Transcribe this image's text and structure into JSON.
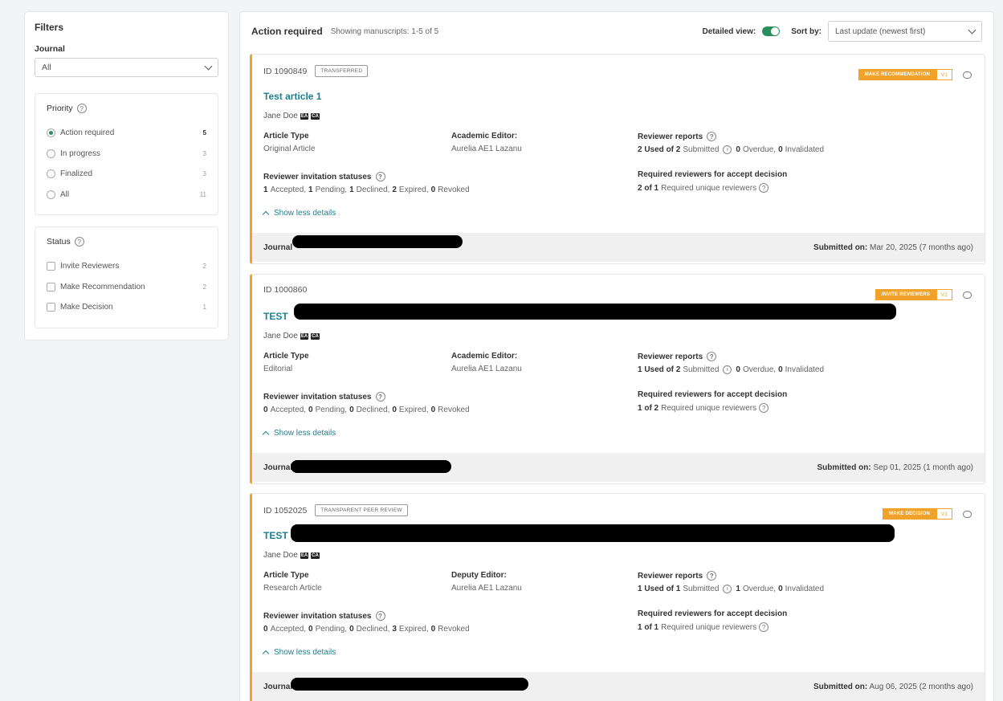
{
  "sidebar": {
    "title": "Filters",
    "journal_label": "Journal",
    "journal_value": "All",
    "priority": {
      "title": "Priority",
      "options": [
        {
          "label": "Action required",
          "count": "5",
          "selected": true
        },
        {
          "label": "In progress",
          "count": "3",
          "selected": false
        },
        {
          "label": "Finalized",
          "count": "3",
          "selected": false
        },
        {
          "label": "All",
          "count": "11",
          "selected": false
        }
      ]
    },
    "status": {
      "title": "Status",
      "options": [
        {
          "label": "Invite Reviewers",
          "count": "2"
        },
        {
          "label": "Make Recommendation",
          "count": "2"
        },
        {
          "label": "Make Decision",
          "count": "1"
        }
      ]
    }
  },
  "header": {
    "title": "Action required",
    "showing": "Showing manuscripts: 1-5 of 5",
    "detailed_view_label": "Detailed view:",
    "sort_label": "Sort by:",
    "sort_value": "Last update (newest first)"
  },
  "cards": [
    {
      "id": "ID 1090849",
      "pill": "TRANSFERRED",
      "badge": "MAKE RECOMMENDATION",
      "version": "V1",
      "title": "Test article 1",
      "author": "Jane Doe",
      "tags": [
        "EA",
        "CA"
      ],
      "article_type_label": "Article Type",
      "article_type": "Original Article",
      "editor_label": "Academic Editor:",
      "editor": "Aurelia AE1 Lazanu",
      "reports_label": "Reviewer reports",
      "reports_used": "2 Used of 2",
      "reports_submitted": "Submitted",
      "reports_overdue": "0",
      "reports_overdue_label": "Overdue,",
      "reports_invalid": "0",
      "reports_invalid_label": "Invalidated",
      "invites_label": "Reviewer invitation statuses",
      "inv": [
        "1",
        "1",
        "1",
        "2",
        "0"
      ],
      "required_label": "Required reviewers for accept decision",
      "required_count": "2 of 1",
      "required_text": "Required unique reviewers",
      "show_less": "Show less details",
      "journal": "Journal",
      "submitted_label": "Submitted on:",
      "submitted": "Mar 20, 2025 (7 months ago)"
    },
    {
      "id": "ID 1000860",
      "pill": "",
      "badge": "INVITE REVIEWERS",
      "version": "V2",
      "title": "TEST",
      "author": "Jane Doe",
      "tags": [
        "EA",
        "CA"
      ],
      "article_type_label": "Article Type",
      "article_type": "Editorial",
      "editor_label": "Academic Editor:",
      "editor": "Aurelia AE1 Lazanu",
      "reports_label": "Reviewer reports",
      "reports_used": "1 Used of 2",
      "reports_submitted": "Submitted",
      "reports_overdue": "0",
      "reports_overdue_label": "Overdue,",
      "reports_invalid": "0",
      "reports_invalid_label": "Invalidated",
      "invites_label": "Reviewer invitation statuses",
      "inv": [
        "0",
        "0",
        "0",
        "0",
        "0"
      ],
      "required_label": "Required reviewers for accept decision",
      "required_count": "1 of 2",
      "required_text": "Required unique reviewers",
      "show_less": "Show less details",
      "journal": "Journal",
      "submitted_label": "Submitted on:",
      "submitted": "Sep 01, 2025 (1 month ago)"
    },
    {
      "id": "ID 1052025",
      "pill": "TRANSPARENT PEER REVIEW",
      "badge": "MAKE DECISION",
      "version": "V1",
      "title": "TEST",
      "author": "Jane Doe",
      "tags": [
        "EA",
        "CA"
      ],
      "article_type_label": "Article Type",
      "article_type": "Research Article",
      "editor_label": "Deputy Editor:",
      "editor": "Aurelia AE1 Lazanu",
      "reports_label": "Reviewer reports",
      "reports_used": "1 Used of 1",
      "reports_submitted": "Submitted",
      "reports_overdue": "1",
      "reports_overdue_label": "Overdue,",
      "reports_invalid": "0",
      "reports_invalid_label": "Invalidated",
      "invites_label": "Reviewer invitation statuses",
      "inv": [
        "0",
        "0",
        "0",
        "3",
        "0"
      ],
      "required_label": "Required reviewers for accept decision",
      "required_count": "1 of 1",
      "required_text": "Required unique reviewers",
      "show_less": "Show less details",
      "journal": "Journal",
      "submitted_label": "Submitted on:",
      "submitted": "Aug 06, 2025 (2 months ago)"
    }
  ],
  "inv_labels": [
    "Accepted,",
    "Pending,",
    "Declined,",
    "Expired,",
    "Revoked"
  ],
  "colors": {
    "accent": "#f0a22b",
    "link": "#1f7f8f",
    "toggle": "#2a8f5f"
  }
}
